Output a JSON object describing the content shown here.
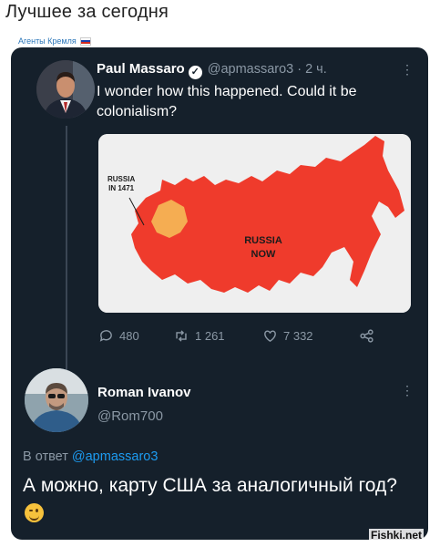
{
  "page": {
    "title": "Лучшее за сегодня",
    "source_label": "Агенты Кремля",
    "source_flag_colors": [
      "#ffffff",
      "#1c3faa",
      "#d52b1e"
    ],
    "watermark": "Fishki.net"
  },
  "tweet": {
    "author_name": "Paul Massaro",
    "verified_icon": "verified-badge-icon",
    "handle": "@apmassaro3",
    "separator": "·",
    "time": "2 ч.",
    "more": "⋮",
    "text": "I wonder how this happened. Could it be colonialism?",
    "image": {
      "label_small": "RUSSIA\nIN 1471",
      "label_small_line1": "RUSSIA",
      "label_small_line2": "IN 1471",
      "label_large_line1": "RUSSIA",
      "label_large_line2": "NOW",
      "colors": {
        "background": "#efefef",
        "russia_now": "#ef3b2c",
        "russia_1471": "#f5ad52"
      }
    },
    "actions": {
      "replies": "480",
      "retweets": "1 261",
      "likes": "7 332",
      "reply_icon": "comment-icon",
      "retweet_icon": "retweet-icon",
      "like_icon": "heart-icon",
      "share_icon": "share-icon"
    }
  },
  "reply": {
    "author_name": "Roman Ivanov",
    "handle": "@Rom700",
    "more": "⋮",
    "reply_prefix": "В ответ",
    "reply_to_handle": "@apmassaro3",
    "text": "А можно, карту США за аналогичный год?",
    "emoji_icon": "winking-face-emoji-icon"
  },
  "colors": {
    "card_bg": "#15202b",
    "text_primary": "#ffffff",
    "text_secondary": "#8b98a5",
    "link": "#1d9bf0"
  }
}
